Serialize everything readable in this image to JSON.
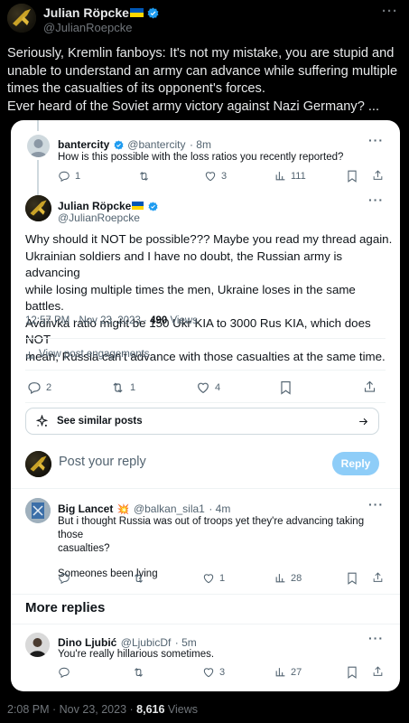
{
  "outer": {
    "author_name": "Julian Röpcke",
    "author_handle": "@JulianRoepcke",
    "text_lines": [
      "Seriously, Kremlin fanboys: It's not my mistake, you are stupid and",
      "unable to understand an army can advance while suffering multiple",
      "times the casualties of its opponent's forces.",
      "Ever heard of the Soviet army victory against Nazi Germany? ..."
    ],
    "timestamp": "2:08 PM · Nov 23, 2023 · ",
    "views_count": "8,616",
    "views_label": " Views"
  },
  "card": {
    "reply1": {
      "name": "bantercity",
      "handle": "@bantercity",
      "time": "· 8m",
      "text": "How is this possible with the loss ratios you recently reported?",
      "replies": "1",
      "retweets": "",
      "likes": "3",
      "views": "111"
    },
    "focus": {
      "name": "Julian Röpcke",
      "handle": "@JulianRoepcke",
      "text_lines": [
        "Why should it NOT be possible??? Maybe you read my thread again.",
        "Ukrainian soldiers and I have no doubt, the Russian army is advancing",
        "while losing multiple times the men, Ukraine loses in the same battles.",
        "Avdiivka ratio might be 150 Ukr KIA to 3000 Rus KIA, which does NOT",
        "mean, Russia can't advance with those casualties at the same time."
      ],
      "timestamp": "12:57 PM · Nov 23, 2023 · ",
      "views_count": "490",
      "views_label": " Views",
      "engagements": "View post engagements",
      "replies": "2",
      "retweets": "1",
      "likes": "4",
      "similar": "See similar posts"
    },
    "compose": {
      "placeholder": "Post your reply",
      "button": "Reply"
    },
    "reply2": {
      "name": "Big Lancet",
      "emoji": "💥",
      "handle": "@balkan_sila1",
      "time": "· 4m",
      "text_lines": [
        "But i thought Russia was out of troops yet they're advancing taking those",
        "casualties?"
      ],
      "text_extra": "Someones been lying",
      "replies": "",
      "retweets": "",
      "likes": "1",
      "views": "28"
    },
    "more_replies": "More replies",
    "reply3": {
      "name": "Dino Ljubić",
      "handle": "@LjubicDf",
      "time": "· 5m",
      "text": "You're really hillarious sometimes.",
      "replies": "",
      "retweets": "",
      "likes": "3",
      "views": "27"
    }
  },
  "colors": {
    "accent": "#1d9bf0",
    "reply_button": "#8ecdf8",
    "muted": "#536471"
  }
}
